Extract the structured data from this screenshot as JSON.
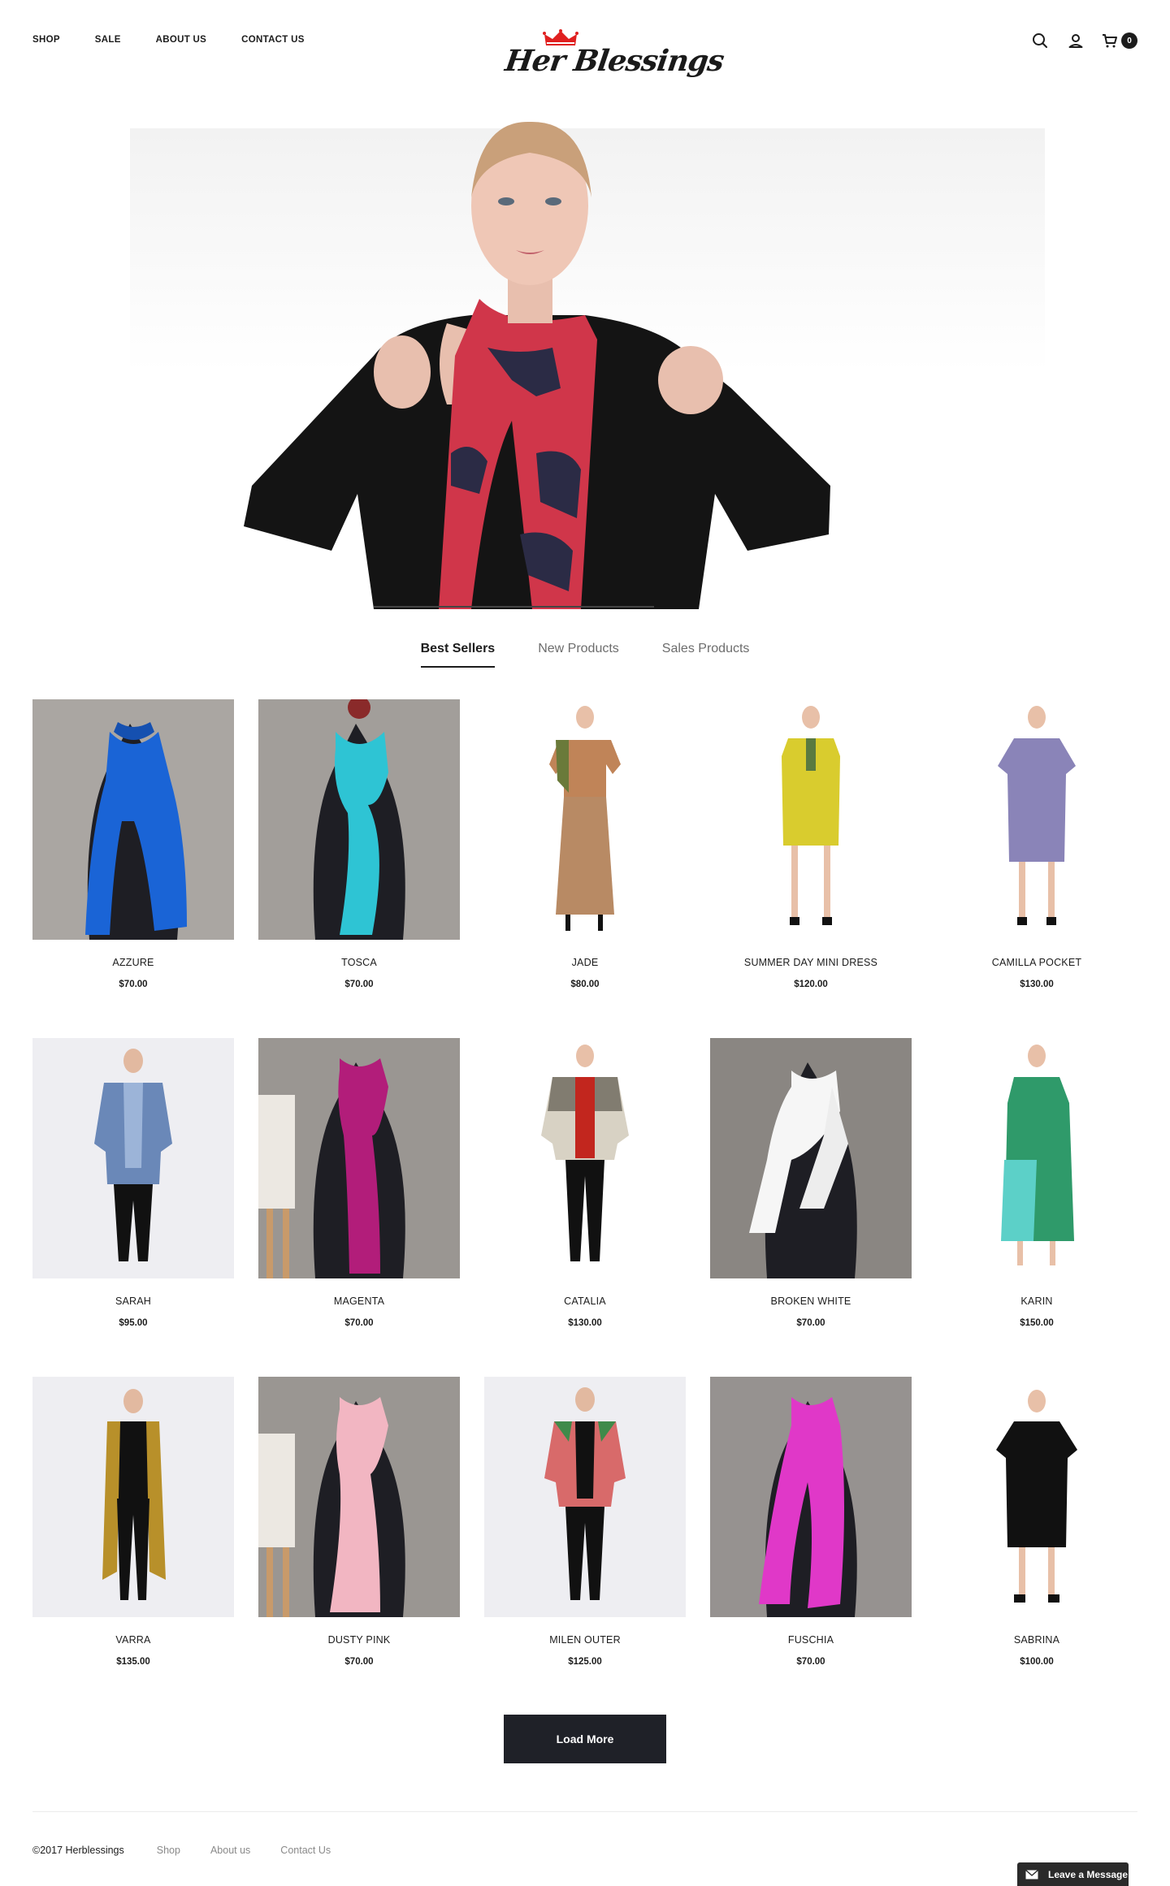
{
  "nav": {
    "items": [
      {
        "label": "SHOP"
      },
      {
        "label": "SALE"
      },
      {
        "label": "ABOUT US"
      },
      {
        "label": "CONTACT US"
      }
    ]
  },
  "brand": {
    "logo_text": "Her Blessings",
    "logo_crown_color": "#e02020"
  },
  "header_icons": {
    "search": "search-icon",
    "account": "user-icon",
    "cart": "cart-icon",
    "cart_count": "0"
  },
  "tabs": [
    {
      "label": "Best Sellers",
      "active": true
    },
    {
      "label": "New Products",
      "active": false
    },
    {
      "label": "Sales Products",
      "active": false
    }
  ],
  "products": [
    {
      "name": "AZZURE",
      "price": "$70.00",
      "image": "blue scarf on mannequin"
    },
    {
      "name": "TOSCA",
      "price": "$70.00",
      "image": "turquoise scarf on mannequin"
    },
    {
      "name": "JADE",
      "price": "$80.00",
      "image": "model in tan skirt and top"
    },
    {
      "name": "SUMMER DAY MINI DRESS",
      "price": "$120.00",
      "image": "model in yellow dress"
    },
    {
      "name": "CAMILLA POCKET",
      "price": "$130.00",
      "image": "model in lilac dress"
    },
    {
      "name": "SARAH",
      "price": "$95.00",
      "image": "model in blue patterned jacket"
    },
    {
      "name": "MAGENTA",
      "price": "$70.00",
      "image": "magenta scarf on mannequin"
    },
    {
      "name": "CATALIA",
      "price": "$130.00",
      "image": "model in patterned outer"
    },
    {
      "name": "BROKEN WHITE",
      "price": "$70.00",
      "image": "white scarf on mannequin"
    },
    {
      "name": "KARIN",
      "price": "$150.00",
      "image": "model in green and aqua dress"
    },
    {
      "name": "VARRA",
      "price": "$135.00",
      "image": "model in patterned long vest"
    },
    {
      "name": "DUSTY PINK",
      "price": "$70.00",
      "image": "pink scarf on mannequin"
    },
    {
      "name": "MILEN OUTER",
      "price": "$125.00",
      "image": "model in pink patterned outer"
    },
    {
      "name": "FUSCHIA",
      "price": "$70.00",
      "image": "fuchsia scarf on mannequin"
    },
    {
      "name": "SABRINA",
      "price": "$100.00",
      "image": "model in black dress"
    }
  ],
  "load_more": {
    "label": "Load More"
  },
  "footer": {
    "copyright": "©2017 Herblessings",
    "links": [
      {
        "label": "Shop"
      },
      {
        "label": "About us"
      },
      {
        "label": "Contact Us"
      }
    ]
  },
  "chat": {
    "label": "Leave a Message"
  },
  "colors": {
    "text": "#1c1c1c",
    "button_bg": "#1f2128",
    "muted": "#8a8a8a"
  }
}
